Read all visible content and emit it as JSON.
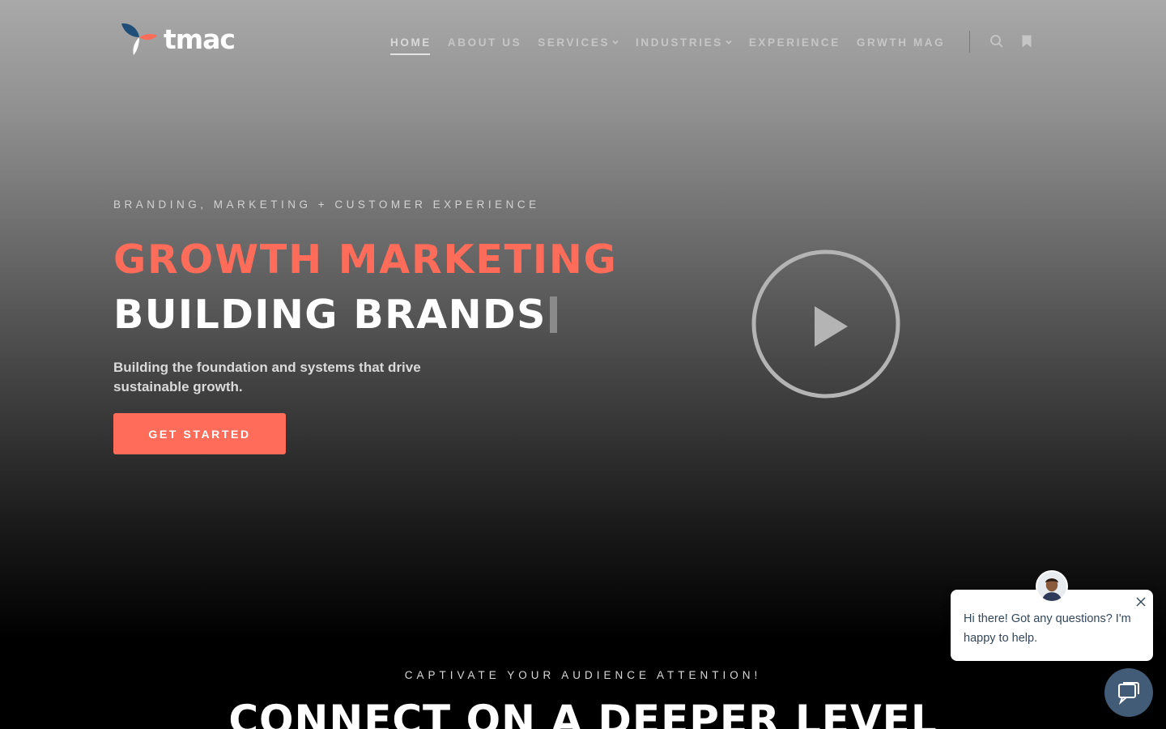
{
  "brand": {
    "name": "tmac",
    "accent": "#ff6d5a",
    "logo_blue": "#1f4e79"
  },
  "nav": {
    "items": [
      {
        "label": "HOME",
        "active": true,
        "dropdown": false
      },
      {
        "label": "ABOUT US",
        "active": false,
        "dropdown": false
      },
      {
        "label": "SERVICES",
        "active": false,
        "dropdown": true
      },
      {
        "label": "INDUSTRIES",
        "active": false,
        "dropdown": true
      },
      {
        "label": "EXPERIENCE",
        "active": false,
        "dropdown": false
      },
      {
        "label": "GRWTH MAG",
        "active": false,
        "dropdown": false
      }
    ],
    "icons": [
      "search-icon",
      "bookmark-icon"
    ]
  },
  "hero": {
    "eyebrow": "BRANDING, MARKETING + CUSTOMER EXPERIENCE",
    "headline_1": "GROWTH MARKETING",
    "headline_2": "BUILDING BRANDS",
    "subtext": "Building the foundation and systems that drive sustainable growth.",
    "cta_label": "GET STARTED",
    "video_icon": "play-icon"
  },
  "section": {
    "eyebrow": "CAPTIVATE YOUR AUDIENCE ATTENTION!",
    "title": "CONNECT ON A DEEPER LEVEL"
  },
  "chat": {
    "message": "Hi there! Got any questions? I'm happy to help.",
    "launcher_color": "#425b76"
  }
}
